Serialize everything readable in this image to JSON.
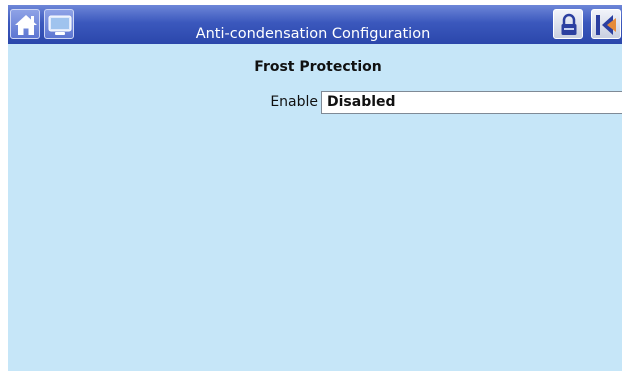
{
  "header": {
    "title": "Anti-condensation Configuration",
    "icons": [
      "home-icon",
      "screen-icon",
      "lock-icon",
      "back-icon"
    ]
  },
  "section": {
    "title": "Frost Protection"
  },
  "fields": [
    {
      "label": "Enable",
      "value": "Disabled"
    }
  ],
  "colors": {
    "header_blue": "#3b58bd",
    "background": "#c6e6f8",
    "field_background": "#ffffff"
  }
}
